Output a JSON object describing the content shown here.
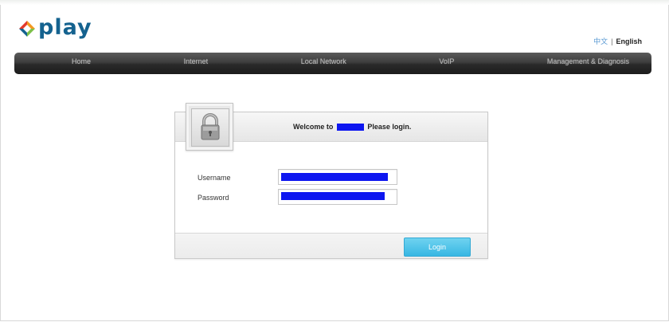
{
  "brand": {
    "name": "play",
    "logo_icon": "diamond-logo-icon",
    "colors": {
      "blue": "#14628f",
      "red": "#e33a2c",
      "orange": "#f39a21",
      "green": "#7cc04a"
    }
  },
  "language": {
    "chinese": "中文",
    "separator": "|",
    "english": "English"
  },
  "nav": {
    "items": [
      {
        "label": "Home"
      },
      {
        "label": "Internet"
      },
      {
        "label": "Local Network"
      },
      {
        "label": "VoIP"
      },
      {
        "label": "Management & Diagnosis"
      }
    ]
  },
  "login": {
    "lock_icon": "padlock-icon",
    "welcome_prefix": "Welcome to",
    "welcome_suffix": "Please login.",
    "username_label": "Username",
    "username_value": "",
    "password_label": "Password",
    "password_value": "",
    "button_label": "Login",
    "button_color": "#38b7e3",
    "redaction_color": "#0d16f0"
  }
}
